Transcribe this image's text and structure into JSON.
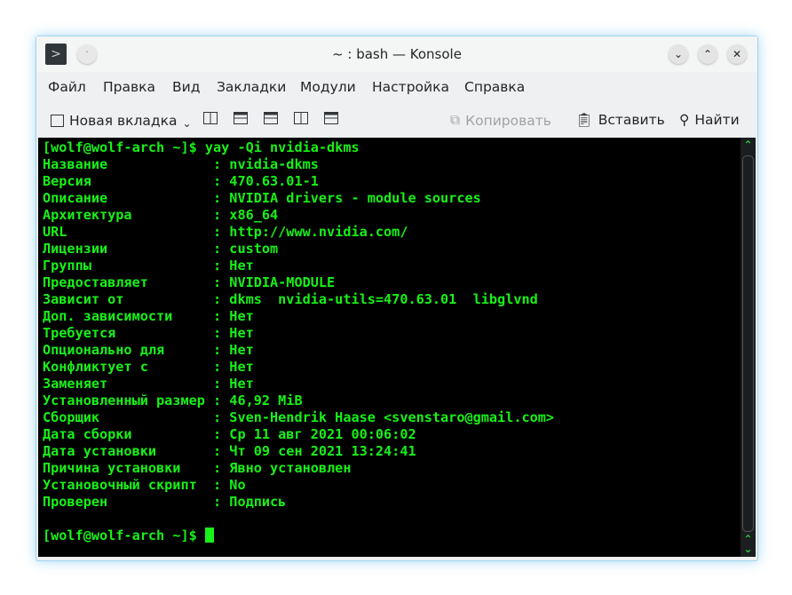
{
  "window": {
    "title": "~ : bash — Konsole"
  },
  "menu": [
    "Файл",
    "Правка",
    "Вид",
    "Закладки",
    "Модули",
    "Настройка",
    "Справка"
  ],
  "toolbar": {
    "new_tab": "Новая вкладка",
    "copy": "Копировать",
    "paste": "Вставить",
    "find": "Найти"
  },
  "terminal": {
    "command_line": "[wolf@wolf-arch ~]$ yay -Qi nvidia-dkms",
    "lines": [
      "Название             : nvidia-dkms",
      "Версия               : 470.63.01-1",
      "Описание             : NVIDIA drivers - module sources",
      "Архитектура          : x86_64",
      "URL                  : http://www.nvidia.com/",
      "Лицензии             : custom",
      "Группы               : Нет",
      "Предоставляет        : NVIDIA-MODULE",
      "Зависит от           : dkms  nvidia-utils=470.63.01  libglvnd",
      "Доп. зависимости     : Нет",
      "Требуется            : Нет",
      "Опционально для      : Нет",
      "Конфликтует с        : Нет",
      "Заменяет             : Нет",
      "Установленный размер : 46,92 MiB",
      "Сборщик              : Sven-Hendrik Haase <svenstaro@gmail.com>",
      "Дата сборки          : Ср 11 авг 2021 00:06:02",
      "Дата установки       : Чт 09 сен 2021 13:24:41",
      "Причина установки    : Явно установлен",
      "Установочный скрипт  : No",
      "Проверен             : Подпись"
    ],
    "prompt": "[wolf@wolf-arch ~]$ "
  }
}
